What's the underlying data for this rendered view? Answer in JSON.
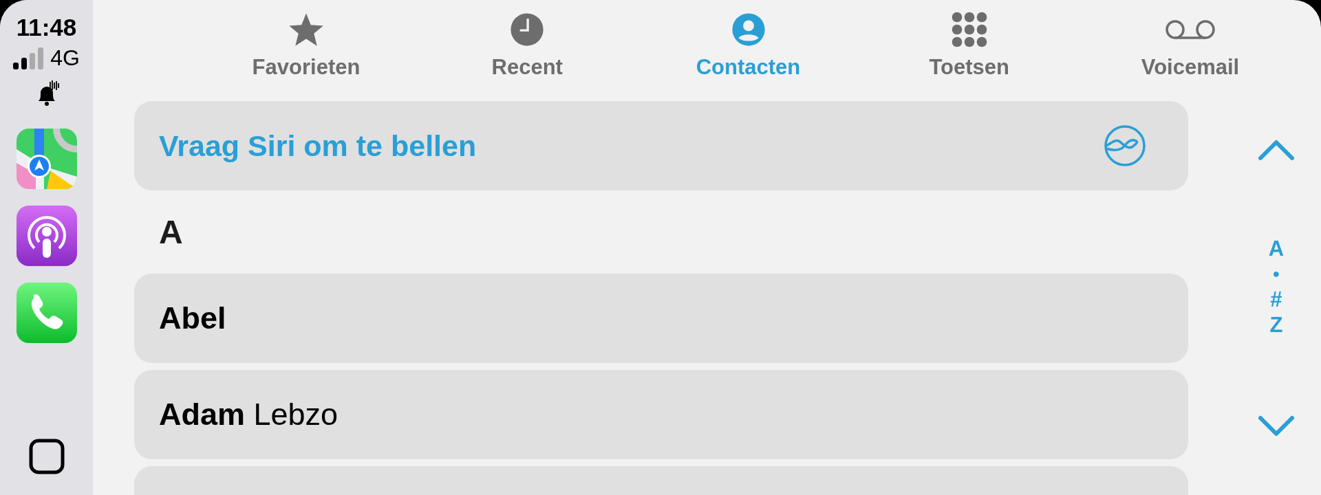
{
  "status": {
    "time": "11:48",
    "network": "4G"
  },
  "dock_apps": [
    {
      "kind": "maps"
    },
    {
      "kind": "podcasts"
    },
    {
      "kind": "phone"
    }
  ],
  "tabs": [
    {
      "label": "Favorieten",
      "kind": "star",
      "selected": false
    },
    {
      "label": "Recent",
      "kind": "clock",
      "selected": false
    },
    {
      "label": "Contacten",
      "kind": "person",
      "selected": true
    },
    {
      "label": "Toetsen",
      "kind": "keypad",
      "selected": false
    },
    {
      "label": "Voicemail",
      "kind": "voicemail",
      "selected": false
    }
  ],
  "siri_button": {
    "label": "Vraag Siri om te bellen"
  },
  "sections": [
    {
      "letter": "A",
      "contacts": [
        {
          "name": "Abel"
        },
        {
          "name": "**Adam** Lebzo"
        }
      ]
    }
  ],
  "index": [
    "A",
    "●",
    "#",
    "Z"
  ]
}
